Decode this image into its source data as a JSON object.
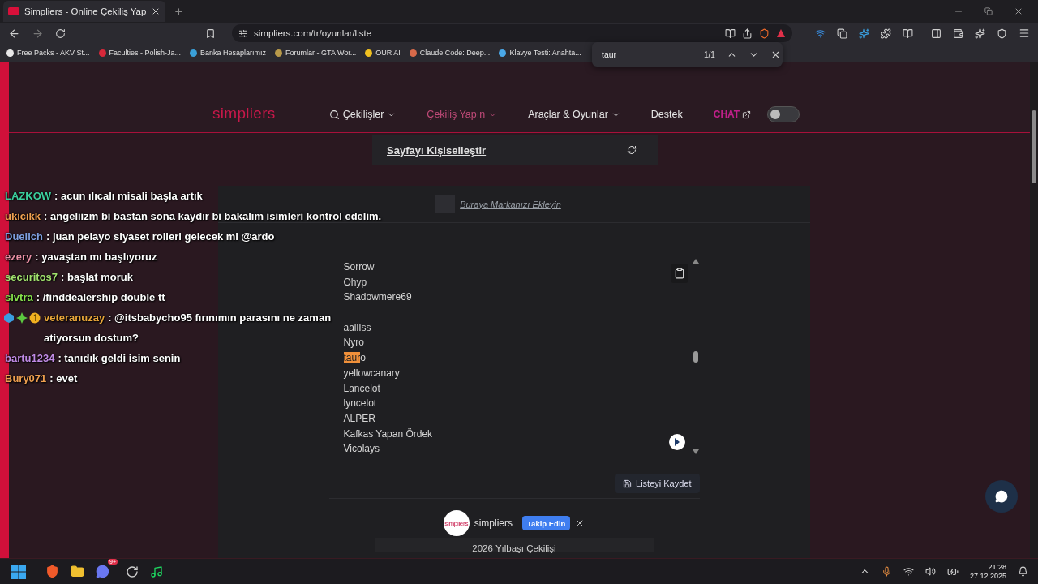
{
  "browser": {
    "tab_title": "Simpliers - Online Çekiliş Yap",
    "url": "simpliers.com/tr/oyunlar/liste",
    "bookmarks": [
      {
        "label": "Free Packs - AKV St...",
        "color": "#e8e8e8"
      },
      {
        "label": "Faculties - Polish-Ja...",
        "color": "#d8283a"
      },
      {
        "label": "Banka Hesaplarımız",
        "color": "#3aa0d8"
      },
      {
        "label": "Forumlar - GTA Wor...",
        "color": "#b89a4a"
      },
      {
        "label": "OUR AI",
        "color": "#f0c020"
      },
      {
        "label": "Claude Code: Deep...",
        "color": "#d86a4a"
      },
      {
        "label": "Klavye Testi: Anahta...",
        "color": "#4aa8e8"
      }
    ]
  },
  "find_bar": {
    "value": "taur",
    "count": "1/1"
  },
  "nav": {
    "logo": "simpliers",
    "theme_toggle": {
      "on": false
    },
    "items": [
      {
        "label": "Çekilişler",
        "kind": "search-dropdown",
        "selected": false
      },
      {
        "label": "Çekiliş Yapın",
        "kind": "dropdown",
        "selected": true
      },
      {
        "label": "Araçlar & Oyunlar",
        "kind": "dropdown",
        "selected": false
      },
      {
        "label": "Destek",
        "kind": "link",
        "selected": false
      },
      {
        "label": "CHAT",
        "kind": "external",
        "selected": false
      }
    ]
  },
  "customize": {
    "title": "Sayfayı Kişiselleştir"
  },
  "brand_link": "Buraya Markanızı Ekleyin",
  "names_list": [
    {
      "kind": "name",
      "text": "Sorrow"
    },
    {
      "kind": "name",
      "text": "Ohyp"
    },
    {
      "kind": "name",
      "text": "Shadowmere69"
    },
    {
      "kind": "covered"
    },
    {
      "kind": "name",
      "text": "aallIss"
    },
    {
      "kind": "name",
      "text": "Nyro"
    },
    {
      "kind": "match",
      "match": "taur",
      "rest": "o"
    },
    {
      "kind": "name",
      "text": "yellowcanary"
    },
    {
      "kind": "name",
      "text": "Lancelot"
    },
    {
      "kind": "name",
      "text": "lyncelot"
    },
    {
      "kind": "name",
      "text": "ALPER"
    },
    {
      "kind": "name",
      "text": "Kafkas Yapan Ördek"
    },
    {
      "kind": "name",
      "text": "Vicolays"
    }
  ],
  "save_button": "Listeyi Kaydet",
  "footer": {
    "logo": "simpliers",
    "name": "simpliers",
    "follow": "Takip Edin",
    "next": "2026 Yılbaşı Çekilişi"
  },
  "chat": [
    {
      "user": "LAZKOW",
      "color": "#3ccf9e",
      "message": ": acun ılıcalı misali başla artık"
    },
    {
      "user": "ukicikk",
      "color": "#f0a050",
      "message": ": angeliizm bi bastan sona kaydır bi bakalım isimleri kontrol edelim."
    },
    {
      "user": "Duelich",
      "color": "#7f9fe0",
      "message": ": juan pelayo siyaset rolleri gelecek mi @ardo"
    },
    {
      "user": "ezery",
      "color": "#e88ea4",
      "message": ": yavaştan mı başlıyoruz"
    },
    {
      "user": "securitos7",
      "color": "#a2e36e",
      "message": ": başlat moruk"
    },
    {
      "user": "slvtra",
      "color": "#86e04c",
      "message": ": /finddealership double tt"
    },
    {
      "user": "veteranuzay",
      "color": "#e8a63a",
      "badges": [
        {
          "kind": "cube"
        },
        {
          "kind": "gem"
        },
        {
          "kind": "coin"
        }
      ],
      "message": ": @itsbabycho95 fırınımın parasını ne zaman atiyorsun dostum?"
    },
    {
      "user": "bartu1234",
      "color": "#c08ae4",
      "message": ": tanıdık geldi isim senin"
    },
    {
      "user": "Bury071",
      "color": "#f0a050",
      "message": ": evet"
    }
  ],
  "taskbar": {
    "discord_badge": "9+",
    "time": "21:28",
    "date": "27.12.2025"
  }
}
